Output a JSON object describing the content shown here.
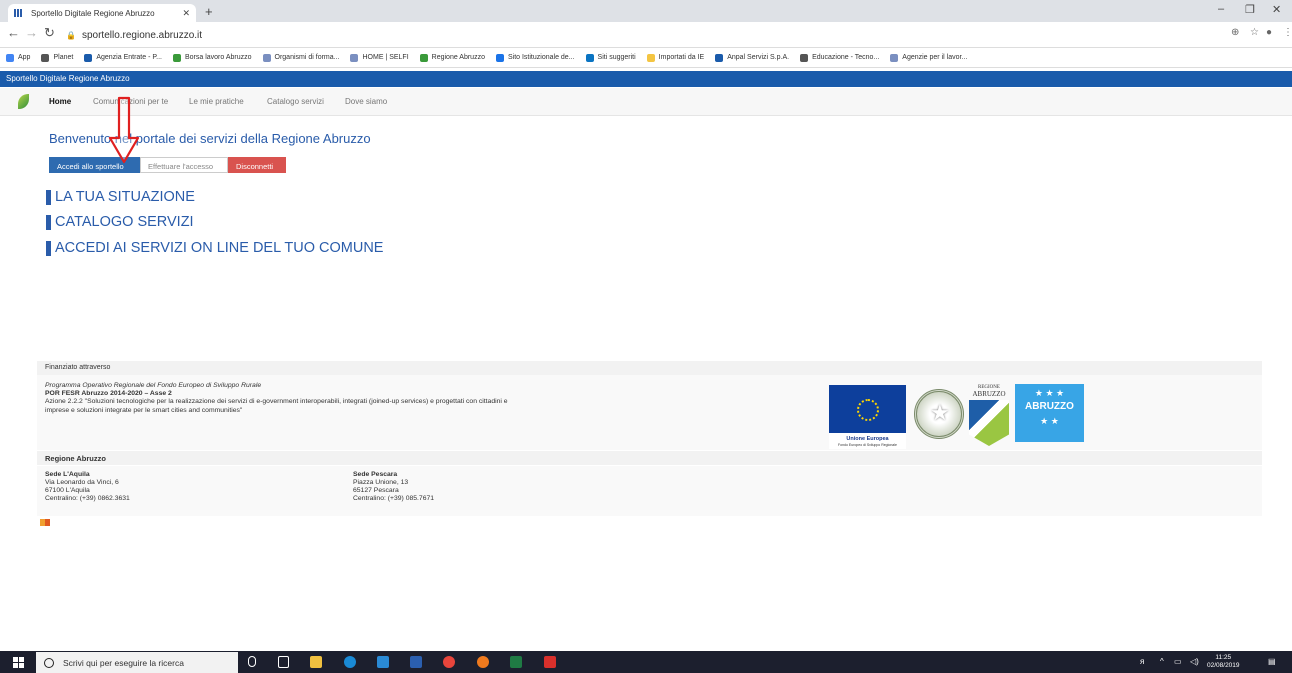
{
  "browser": {
    "tab_title": "Sportello Digitale Regione Abruzzo",
    "tab_close": "✕",
    "new_tab": "+",
    "url": "sportello.regione.abruzzo.it",
    "window_controls": [
      "–",
      "❐",
      "✕"
    ],
    "nav_icons": [
      "back-icon",
      "forward-icon",
      "reload-icon"
    ],
    "bookmarks": [
      {
        "label": "App",
        "color": "#4285f4"
      },
      {
        "label": "Planet",
        "color": "#555555"
      },
      {
        "label": "Agenzia Entrate - P...",
        "color": "#1a5bab"
      },
      {
        "label": "Borsa lavoro Abruzzo",
        "color": "#3a9a3a"
      },
      {
        "label": "Organismi di forma...",
        "color": "#7a8fc0"
      },
      {
        "label": "HOME | SELFI",
        "color": "#7a8fc0"
      },
      {
        "label": "Regione Abruzzo",
        "color": "#3a9a3a"
      },
      {
        "label": "Sito Istituzionale de...",
        "color": "#1a73e8"
      },
      {
        "label": "Siti suggeriti",
        "color": "#0a74c2"
      },
      {
        "label": "Importati da IE",
        "color": "#f4c542"
      },
      {
        "label": "Anpal Servizi S.p.A.",
        "color": "#1a5bab"
      },
      {
        "label": "Educazione - Tecno...",
        "color": "#555555"
      },
      {
        "label": "Agenzie per il lavor...",
        "color": "#7a8fc0"
      }
    ]
  },
  "page": {
    "site_title": "Sportello Digitale Regione Abruzzo",
    "menu": [
      {
        "label": "Home",
        "active": true
      },
      {
        "label": "Comunicazioni per te"
      },
      {
        "label": "Le mie pratiche"
      },
      {
        "label": "Catalogo servizi"
      },
      {
        "label": "Dove siamo"
      }
    ],
    "welcome": "Benvenuto nel portale dei servizi della Regione Abruzzo",
    "buttons": {
      "access": "Accedi allo sportello",
      "login": "Effettuare l'accesso",
      "logout": "Disconnetti"
    },
    "links": [
      "LA TUA SITUAZIONE",
      "CATALOGO SERVIZI",
      "ACCEDI AI SERVIZI ON LINE DEL TUO COMUNE"
    ],
    "accent_color": "#2a5caa"
  },
  "footer": {
    "funding_head": "Finanziato attraverso",
    "program": "Programma Operativo Regionale del Fondo Europeo di Sviluppo Rurale",
    "por": "POR FESR Abruzzo 2014-2020 – Asse 2",
    "action_line1": "Azione 2.2.2 \"Soluzioni tecnologiche per la realizzazione dei servizi di e-government interoperabili, integrati (joined-up services) e progettati con cittadini e",
    "action_line2": "imprese e soluzioni integrate per le smart cities and communities\"",
    "logo_eu_caption": "Unione Europea",
    "logo_eu_sub": "Fondo Europeo di Sviluppo Regionale",
    "logo_ra_top": "REGIONE",
    "logo_ra_name": "ABRUZZO",
    "logo_ab_name": "ABRUZZO",
    "region_head": "Regione Abruzzo",
    "sede_aq": {
      "title": "Sede L'Aquila",
      "street": "Via Leonardo da Vinci, 6",
      "city": "67100 L'Aquila",
      "phone": "Centralino: (+39) 0862.3631"
    },
    "sede_pe": {
      "title": "Sede Pescara",
      "street": "Piazza Unione, 13",
      "city": "65127 Pescara",
      "phone": "Centralino: (+39) 085.7671"
    }
  },
  "taskbar": {
    "search_placeholder": "Scrivi qui per eseguire la ricerca",
    "time": "11:25",
    "date": "02/08/2019"
  }
}
